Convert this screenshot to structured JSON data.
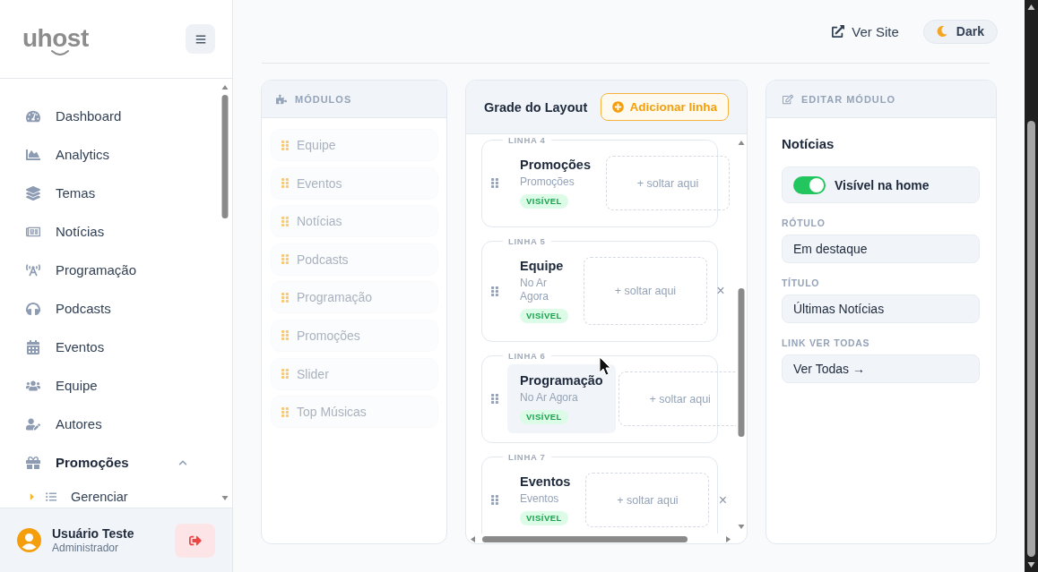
{
  "sidebar": {
    "logo": "uhost",
    "items": [
      {
        "kind": "link",
        "label": "Dashboard"
      },
      {
        "kind": "link",
        "label": "Analytics"
      },
      {
        "kind": "link",
        "label": "Temas"
      },
      {
        "kind": "link",
        "label": "Notícias"
      },
      {
        "kind": "link",
        "label": "Programação"
      },
      {
        "kind": "link",
        "label": "Podcasts"
      },
      {
        "kind": "link",
        "label": "Eventos"
      },
      {
        "kind": "link",
        "label": "Equipe"
      },
      {
        "kind": "link",
        "label": "Autores"
      },
      {
        "kind": "group",
        "label": "Promoções",
        "expanded": true,
        "children": [
          {
            "label": "Gerenciar"
          }
        ]
      }
    ],
    "user": {
      "name": "Usuário Teste",
      "role": "Administrador"
    }
  },
  "topbar": {
    "view_site": "Ver Site",
    "theme_button": "Dark"
  },
  "modules": {
    "title": "MÓDULOS",
    "items": [
      {
        "label": "Equipe",
        "disabled": true
      },
      {
        "label": "Eventos",
        "disabled": true
      },
      {
        "label": "Notícias",
        "disabled": true
      },
      {
        "label": "Podcasts",
        "disabled": true
      },
      {
        "label": "Programação",
        "disabled": true
      },
      {
        "label": "Promoções",
        "disabled": true
      },
      {
        "label": "Slider",
        "disabled": true
      },
      {
        "label": "Top Músicas",
        "disabled": true
      }
    ]
  },
  "grid": {
    "title": "Grade do Layout",
    "add_button": "Adicionar linha",
    "rows": [
      {
        "label": "LINHA 4",
        "modules": [
          {
            "title": "Promoções",
            "subtitle": "Promoções",
            "badge": "VISÍVEL",
            "hovered": false
          }
        ],
        "drop_hint": "+ soltar aqui"
      },
      {
        "label": "LINHA 5",
        "modules": [
          {
            "title": "Equipe",
            "subtitle": "No Ar Agora",
            "badge": "VISÍVEL",
            "hovered": false
          }
        ],
        "drop_hint": "+ soltar aqui",
        "remove": "×"
      },
      {
        "label": "LINHA 6",
        "modules": [
          {
            "title": "Programação",
            "subtitle": "No Ar Agora",
            "badge": "VISÍVEL",
            "hovered": true
          }
        ],
        "drop_hint": "+ soltar aqui"
      },
      {
        "label": "LINHA 7",
        "modules": [
          {
            "title": "Eventos",
            "subtitle": "Eventos",
            "badge": "VISÍVEL",
            "hovered": false
          }
        ],
        "drop_hint": "+ soltar aqui",
        "remove": "×"
      }
    ]
  },
  "editor": {
    "title": "EDITAR MÓDULO",
    "module_name": "Notícias",
    "toggle": {
      "label": "Visível na home",
      "on": true
    },
    "fields": [
      {
        "label": "RÓTULO",
        "value": "Em destaque"
      },
      {
        "label": "TÍTULO",
        "value": "Últimas Notícias"
      },
      {
        "label": "LINK VER TODAS",
        "value": "Ver Todas →"
      }
    ]
  }
}
